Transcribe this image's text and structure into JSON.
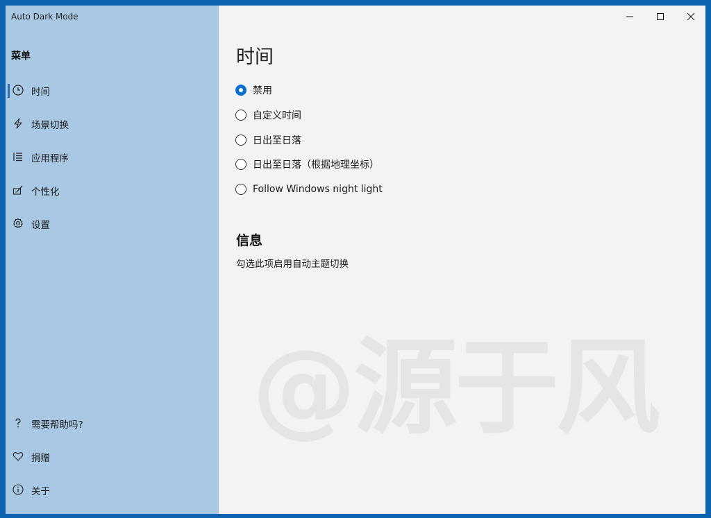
{
  "window": {
    "title": "Auto Dark Mode"
  },
  "sidebar": {
    "menu_header": "菜单",
    "items": [
      {
        "label": "时间",
        "icon": "clock-icon",
        "selected": true
      },
      {
        "label": "场景切换",
        "icon": "lightning-icon",
        "selected": false
      },
      {
        "label": "应用程序",
        "icon": "list-icon",
        "selected": false
      },
      {
        "label": "个性化",
        "icon": "paint-icon",
        "selected": false
      },
      {
        "label": "设置",
        "icon": "gear-icon",
        "selected": false
      }
    ],
    "footer_items": [
      {
        "label": "需要帮助吗?",
        "icon": "question-icon"
      },
      {
        "label": "捐赠",
        "icon": "heart-icon"
      },
      {
        "label": "关于",
        "icon": "info-icon"
      }
    ]
  },
  "content": {
    "title": "时间",
    "options": [
      {
        "label": "禁用",
        "checked": true
      },
      {
        "label": "自定义时间",
        "checked": false
      },
      {
        "label": "日出至日落",
        "checked": false
      },
      {
        "label": "日出至日落（根据地理坐标）",
        "checked": false
      },
      {
        "label": "Follow Windows night light",
        "checked": false
      }
    ],
    "info_title": "信息",
    "info_text": "勾选此项启用自动主题切换"
  },
  "watermark": "@源于风",
  "colors": {
    "accent": "#0a6fd0",
    "sidebar_bg": "#a8c8e4",
    "window_border": "#0d63b0",
    "content_bg": "#f3f3f3"
  }
}
